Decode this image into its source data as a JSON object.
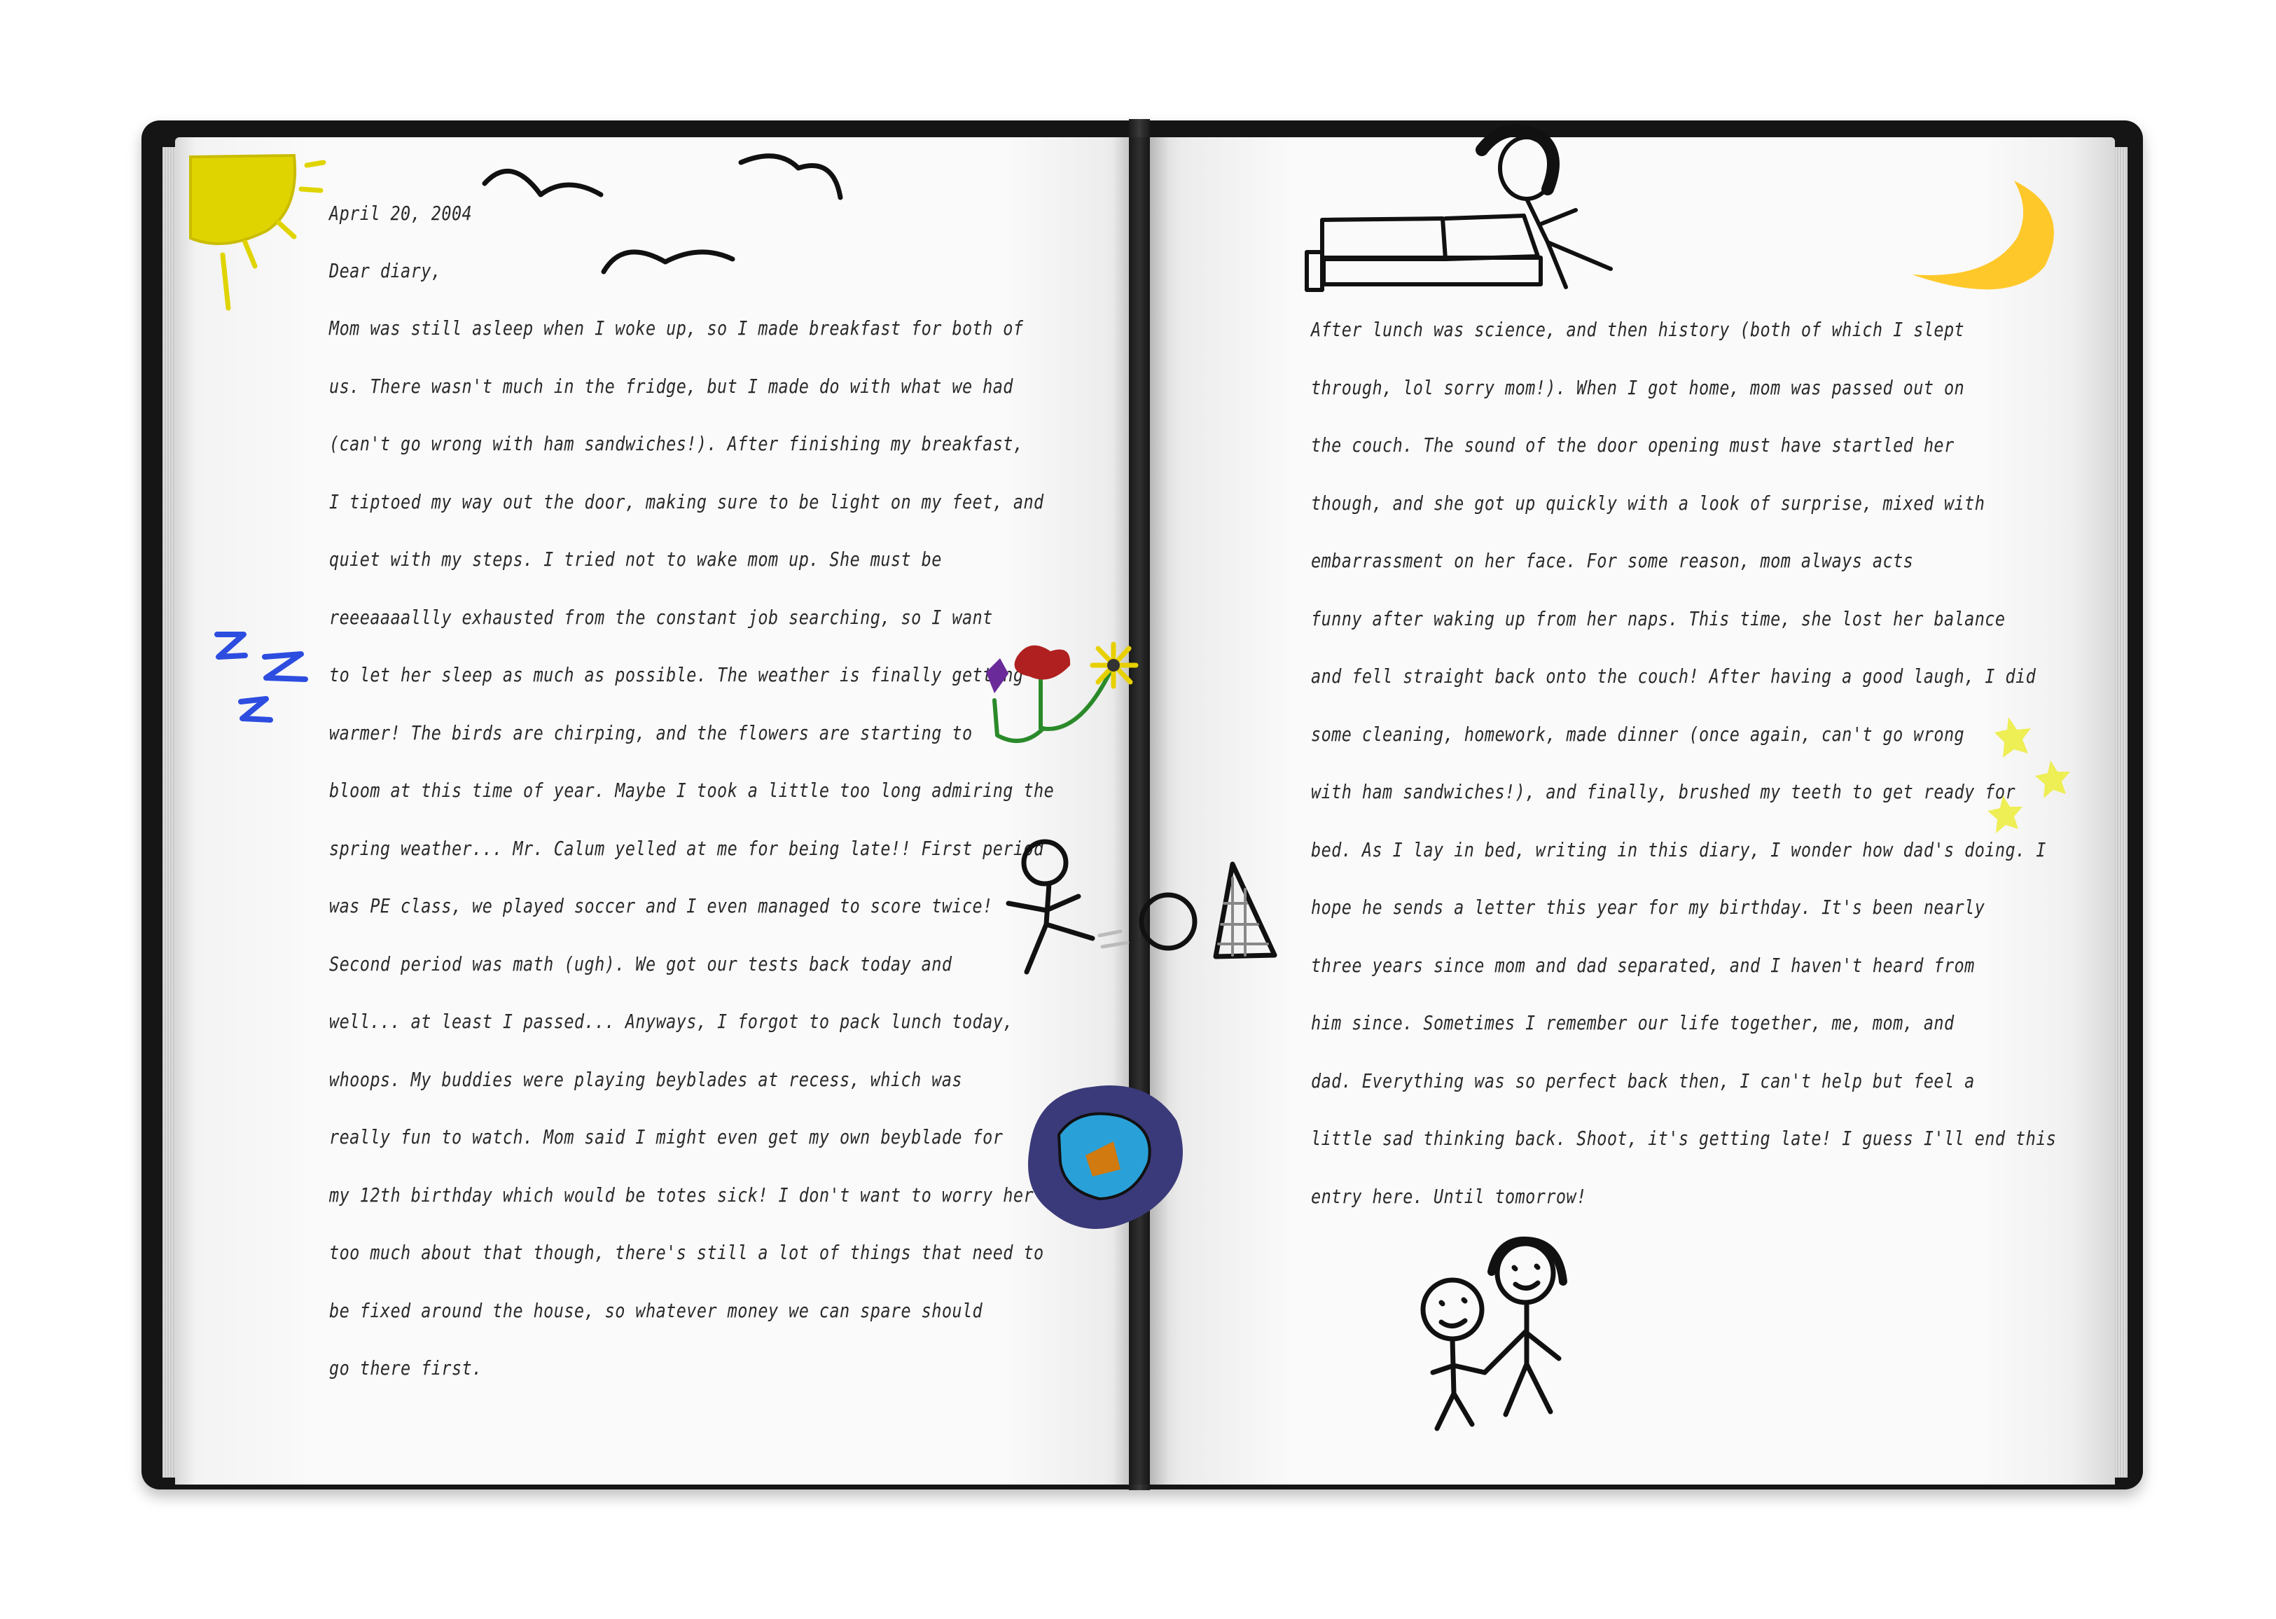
{
  "diary": {
    "date": "April 20, 2004",
    "greeting": "Dear diary,",
    "left_page_lines": [
      "Mom was still asleep when I woke up, so I made breakfast for both of",
      "us. There wasn't much in the fridge, but I made do with what we had",
      "(can't go wrong with ham sandwiches!). After finishing my breakfast,",
      "I tiptoed my way out the door, making sure to be light on my feet, and",
      "quiet with my steps. I tried not to wake mom up. She must be",
      "reeeaaaallly exhausted from the constant job searching, so I want",
      "to let her sleep as much as possible. The weather is finally getting",
      "warmer! The birds are chirping, and the flowers are starting to",
      "bloom at this time of year. Maybe I took a little too long admiring the",
      "spring weather... Mr. Calum yelled at me for being late!! First period",
      "was PE class, we played soccer and I even managed to score twice!",
      "Second period was math (ugh). We got our tests back today and",
      "well... at least I passed... Anyways, I forgot to pack lunch today,",
      "whoops. My buddies were playing beyblades at recess, which was",
      "really fun to watch. Mom said I might even get my own beyblade for",
      "my 12th birthday which would be totes sick! I don't want to worry her",
      "too much about that though, there's still a lot of things that need to",
      "be fixed around the house, so whatever money we can spare should",
      "go there first."
    ],
    "right_page_lines": [
      "After lunch was science, and then history (both of which I slept",
      "through, lol sorry mom!). When I got home, mom was passed out on",
      "the couch. The sound of the door opening must have startled her",
      "though, and she got up quickly with a look of surprise, mixed with",
      "embarrassment on her face. For some reason, mom always acts",
      "funny after waking up from her naps. This time, she lost her balance",
      "and fell straight back onto the couch! After having a good laugh, I did",
      "some cleaning, homework, made dinner (once again, can't go wrong",
      "with ham sandwiches!), and finally, brushed my teeth to get ready for",
      "bed. As I lay in bed, writing in this diary, I wonder how dad's doing. I",
      "hope he sends a letter this year for my birthday. It's been nearly",
      "three years since mom and dad separated, and I haven't heard from",
      "him since. Sometimes I remember our life together, me, mom, and",
      "dad. Everything was so perfect back then, I can't help but feel a",
      "little sad thinking back. Shoot, it's getting late! I guess I'll end this",
      "entry here. Until tomorrow!"
    ]
  },
  "doodles": {
    "sun_icon": "sun",
    "birds_icon": "birds",
    "sleep_icon": "zzz",
    "flowers_icon": "flowers",
    "soccer_icon": "stick-figure-kicking-ball",
    "beyblade_icon": "beyblade",
    "couch_icon": "mom-on-couch",
    "moon_icon": "crescent-moon",
    "stars_icon": "stars",
    "family_icon": "kid-and-mom",
    "sleep_text": "Z Z Z"
  },
  "colors": {
    "book_cover": "#151515",
    "page": "#fafafa",
    "ink": "#2a2a2a",
    "sun": "#e0d400",
    "moon": "#ffc82a",
    "zzz": "#2d4de0",
    "stars": "#eeee55"
  }
}
